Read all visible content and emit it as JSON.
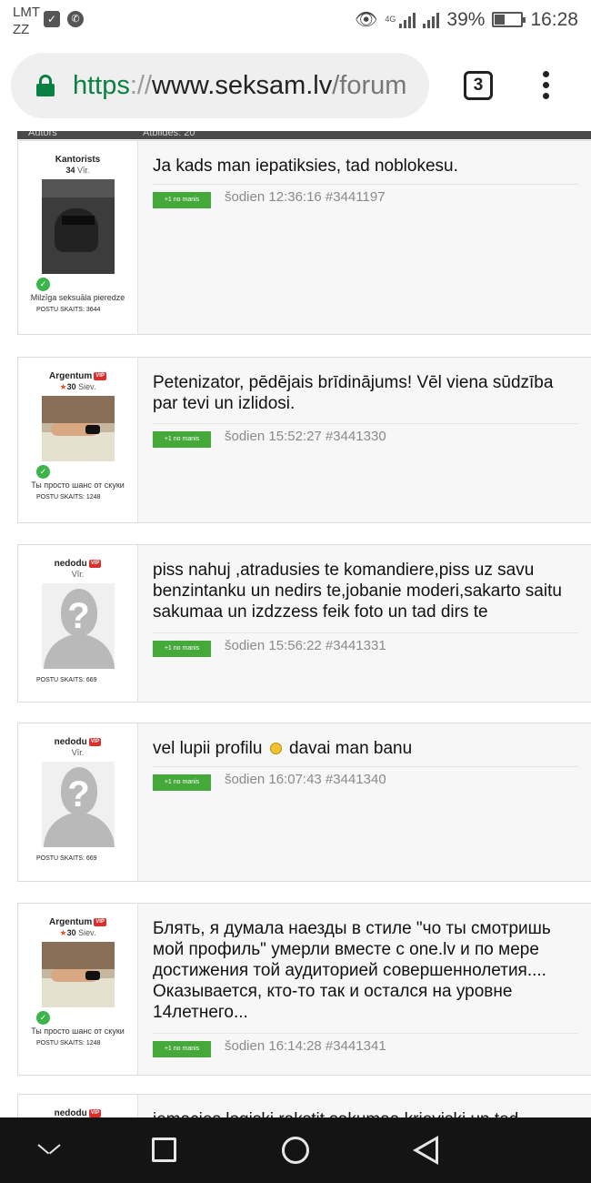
{
  "status_bar": {
    "carrier_line1": "LMT",
    "carrier_line2": "ZZ",
    "network": "4G",
    "battery": "39%",
    "battery_level": 0.39,
    "time": "16:28"
  },
  "browser": {
    "url_scheme": "https",
    "url_sep": "://",
    "url_host": "www.seksam.lv",
    "url_path": "/forum",
    "tab_count": "3"
  },
  "table_header": {
    "author": "Autors",
    "replies": "Atbildes: 20"
  },
  "posts": [
    {
      "username": "Kantorists",
      "age": "34",
      "gender": "Vīr.",
      "status": "Milzīga seksuāla pieredze",
      "post_count": "POSTU SKAITS: 3644",
      "message": "Ja kads man iepatiksies, tad noblokesu.",
      "like_button": "+1 no manis",
      "stamp": "šodien 12:36:16 #3441197"
    },
    {
      "username": "Argentum",
      "badge": "VIP",
      "age": "30",
      "gender": "Siev.",
      "status": "Ты просто шанс от скуки",
      "post_count": "POSTU SKAITS: 1248",
      "message": "Petenizator, pēdējais brīdinājums! Vēl viena sūdzība par tevi un izlidosi.",
      "like_button": "+1 no manis",
      "stamp": "šodien 15:52:27 #3441330"
    },
    {
      "username": "nedodu",
      "badge": "VIP",
      "gender": "Vīr.",
      "post_count": "POSTU SKAITS: 669",
      "message": "piss nahuj ,atradusies te komandiere,piss uz savu benzintanku un nedirs te,jobanie moderi,sakarto saitu sakumaa un izdzzess feik foto un tad dirs te",
      "like_button": "+1 no manis",
      "stamp": "šodien 15:56:22 #3441331"
    },
    {
      "username": "nedodu",
      "badge": "VIP",
      "gender": "Vīr.",
      "post_count": "POSTU SKAITS: 669",
      "message_part1": "vel lupii profilu",
      "message_part2": "davai man banu",
      "like_button": "+1 no manis",
      "stamp": "šodien 16:07:43 #3441340"
    },
    {
      "username": "Argentum",
      "badge": "VIP",
      "age": "30",
      "gender": "Siev.",
      "status": "Ты просто шанс от скуки",
      "post_count": "POSTU SKAITS: 1248",
      "message": "Блять, я думала наезды в стиле \"чо ты смотришь мой профиль\" умерли вместе с one.lv и по мере достижения той аудиторией совершеннолетия.... Оказывается, кто-то так и остался на уровне 14летнего...",
      "like_button": "+1 no manis",
      "stamp": "šodien 16:14:28 #3441341"
    },
    {
      "username": "nedodu",
      "badge": "VIP",
      "message": "iemacies logiski rakstit sakumaa krieviski un ted"
    }
  ],
  "icons": {
    "sim": "sim-check-icon",
    "phone": "phone-icon",
    "eye": "eye-icon",
    "lock": "lock-icon",
    "menu": "more-vert-icon",
    "verified": "check-circle-icon",
    "smiley": "smiley-icon"
  },
  "colors": {
    "secure": "#0b8043",
    "like_button": "#45a83a",
    "vip_badge": "#d9302c",
    "verified": "#3cb44b"
  }
}
